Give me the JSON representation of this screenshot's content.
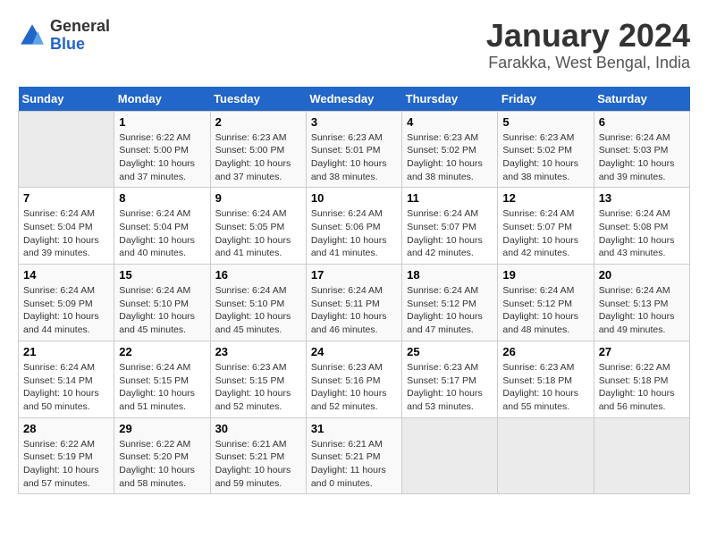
{
  "header": {
    "logo_general": "General",
    "logo_blue": "Blue",
    "title": "January 2024",
    "subtitle": "Farakka, West Bengal, India"
  },
  "calendar": {
    "days_of_week": [
      "Sunday",
      "Monday",
      "Tuesday",
      "Wednesday",
      "Thursday",
      "Friday",
      "Saturday"
    ],
    "weeks": [
      [
        {
          "day": "",
          "info": ""
        },
        {
          "day": "1",
          "info": "Sunrise: 6:22 AM\nSunset: 5:00 PM\nDaylight: 10 hours\nand 37 minutes."
        },
        {
          "day": "2",
          "info": "Sunrise: 6:23 AM\nSunset: 5:00 PM\nDaylight: 10 hours\nand 37 minutes."
        },
        {
          "day": "3",
          "info": "Sunrise: 6:23 AM\nSunset: 5:01 PM\nDaylight: 10 hours\nand 38 minutes."
        },
        {
          "day": "4",
          "info": "Sunrise: 6:23 AM\nSunset: 5:02 PM\nDaylight: 10 hours\nand 38 minutes."
        },
        {
          "day": "5",
          "info": "Sunrise: 6:23 AM\nSunset: 5:02 PM\nDaylight: 10 hours\nand 38 minutes."
        },
        {
          "day": "6",
          "info": "Sunrise: 6:24 AM\nSunset: 5:03 PM\nDaylight: 10 hours\nand 39 minutes."
        }
      ],
      [
        {
          "day": "7",
          "info": "Sunrise: 6:24 AM\nSunset: 5:04 PM\nDaylight: 10 hours\nand 39 minutes."
        },
        {
          "day": "8",
          "info": "Sunrise: 6:24 AM\nSunset: 5:04 PM\nDaylight: 10 hours\nand 40 minutes."
        },
        {
          "day": "9",
          "info": "Sunrise: 6:24 AM\nSunset: 5:05 PM\nDaylight: 10 hours\nand 41 minutes."
        },
        {
          "day": "10",
          "info": "Sunrise: 6:24 AM\nSunset: 5:06 PM\nDaylight: 10 hours\nand 41 minutes."
        },
        {
          "day": "11",
          "info": "Sunrise: 6:24 AM\nSunset: 5:07 PM\nDaylight: 10 hours\nand 42 minutes."
        },
        {
          "day": "12",
          "info": "Sunrise: 6:24 AM\nSunset: 5:07 PM\nDaylight: 10 hours\nand 42 minutes."
        },
        {
          "day": "13",
          "info": "Sunrise: 6:24 AM\nSunset: 5:08 PM\nDaylight: 10 hours\nand 43 minutes."
        }
      ],
      [
        {
          "day": "14",
          "info": "Sunrise: 6:24 AM\nSunset: 5:09 PM\nDaylight: 10 hours\nand 44 minutes."
        },
        {
          "day": "15",
          "info": "Sunrise: 6:24 AM\nSunset: 5:10 PM\nDaylight: 10 hours\nand 45 minutes."
        },
        {
          "day": "16",
          "info": "Sunrise: 6:24 AM\nSunset: 5:10 PM\nDaylight: 10 hours\nand 45 minutes."
        },
        {
          "day": "17",
          "info": "Sunrise: 6:24 AM\nSunset: 5:11 PM\nDaylight: 10 hours\nand 46 minutes."
        },
        {
          "day": "18",
          "info": "Sunrise: 6:24 AM\nSunset: 5:12 PM\nDaylight: 10 hours\nand 47 minutes."
        },
        {
          "day": "19",
          "info": "Sunrise: 6:24 AM\nSunset: 5:12 PM\nDaylight: 10 hours\nand 48 minutes."
        },
        {
          "day": "20",
          "info": "Sunrise: 6:24 AM\nSunset: 5:13 PM\nDaylight: 10 hours\nand 49 minutes."
        }
      ],
      [
        {
          "day": "21",
          "info": "Sunrise: 6:24 AM\nSunset: 5:14 PM\nDaylight: 10 hours\nand 50 minutes."
        },
        {
          "day": "22",
          "info": "Sunrise: 6:24 AM\nSunset: 5:15 PM\nDaylight: 10 hours\nand 51 minutes."
        },
        {
          "day": "23",
          "info": "Sunrise: 6:23 AM\nSunset: 5:15 PM\nDaylight: 10 hours\nand 52 minutes."
        },
        {
          "day": "24",
          "info": "Sunrise: 6:23 AM\nSunset: 5:16 PM\nDaylight: 10 hours\nand 52 minutes."
        },
        {
          "day": "25",
          "info": "Sunrise: 6:23 AM\nSunset: 5:17 PM\nDaylight: 10 hours\nand 53 minutes."
        },
        {
          "day": "26",
          "info": "Sunrise: 6:23 AM\nSunset: 5:18 PM\nDaylight: 10 hours\nand 55 minutes."
        },
        {
          "day": "27",
          "info": "Sunrise: 6:22 AM\nSunset: 5:18 PM\nDaylight: 10 hours\nand 56 minutes."
        }
      ],
      [
        {
          "day": "28",
          "info": "Sunrise: 6:22 AM\nSunset: 5:19 PM\nDaylight: 10 hours\nand 57 minutes."
        },
        {
          "day": "29",
          "info": "Sunrise: 6:22 AM\nSunset: 5:20 PM\nDaylight: 10 hours\nand 58 minutes."
        },
        {
          "day": "30",
          "info": "Sunrise: 6:21 AM\nSunset: 5:21 PM\nDaylight: 10 hours\nand 59 minutes."
        },
        {
          "day": "31",
          "info": "Sunrise: 6:21 AM\nSunset: 5:21 PM\nDaylight: 11 hours\nand 0 minutes."
        },
        {
          "day": "",
          "info": ""
        },
        {
          "day": "",
          "info": ""
        },
        {
          "day": "",
          "info": ""
        }
      ]
    ]
  }
}
